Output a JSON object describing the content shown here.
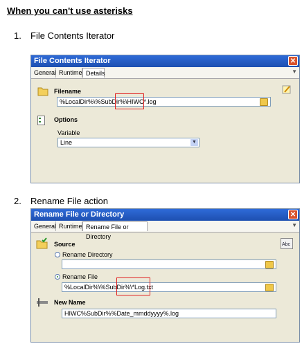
{
  "heading": "When you can't use asterisks",
  "step1": {
    "number": "1.",
    "text": "File Contents Iterator"
  },
  "step2": {
    "number": "2.",
    "text": "Rename File action"
  },
  "window1": {
    "title": "File Contents Iterator",
    "tabs": [
      "General",
      "Runtime",
      "Details"
    ],
    "filename_label": "Filename",
    "filename_value": "%LocalDir%\\%SubDir%\\HIWC*.log",
    "options_label": "Options",
    "variable_label": "Variable",
    "variable_value": "Line"
  },
  "window2": {
    "title": "Rename File or Directory",
    "tabs": [
      "General",
      "Runtime",
      "Rename File or Directory"
    ],
    "source_label": "Source",
    "rename_directory_label": "Rename Directory",
    "rename_directory_value": "",
    "rename_file_label": "Rename File",
    "rename_file_value": "%LocalDir%\\%SubDir%\\*Log.txt",
    "new_name_label": "New Name",
    "new_name_value": "HIWC%SubDir%%Date_mmddyyyy%.log"
  }
}
